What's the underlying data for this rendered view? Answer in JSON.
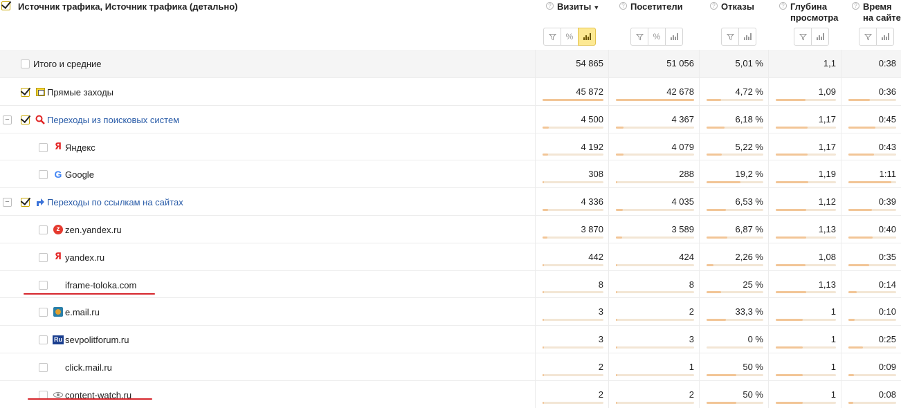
{
  "header": {
    "dimension_title": "Источник трафика, Источник трафика (детально)",
    "metrics": [
      {
        "name": "Визиты",
        "sort_indicator": "▼",
        "buttons": [
          "filter",
          "percent",
          "bars"
        ]
      },
      {
        "name": "Посетители",
        "buttons": [
          "filter",
          "percent",
          "bars"
        ]
      },
      {
        "name": "Отказы",
        "buttons": [
          "filter",
          "bars"
        ]
      },
      {
        "name": "Глубина\nпросмотра",
        "buttons": [
          "filter",
          "bars"
        ]
      },
      {
        "name": "Время\nна сайте",
        "buttons": [
          "filter",
          "bars"
        ]
      }
    ],
    "help_glyph": "?"
  },
  "rows": [
    {
      "label": "Итого и средние",
      "level": 0,
      "checked": false,
      "values": [
        "54 865",
        "51 056",
        "5,01 %",
        "1,1",
        "0:38"
      ],
      "fills": [
        0,
        0,
        0,
        0,
        0
      ]
    },
    {
      "label": "Прямые заходы",
      "level": 0,
      "checked": true,
      "icon": "direct-entry-icon",
      "values": [
        "45 872",
        "42 678",
        "4,72 %",
        "1,09",
        "0:36"
      ],
      "fills": [
        1.0,
        1.0,
        0.25,
        0.49,
        0.45
      ]
    },
    {
      "label": "Переходы из поисковых систем",
      "level": 0,
      "checked": true,
      "expandable": true,
      "link": true,
      "icon": "search-magnifier-icon",
      "values": [
        "4 500",
        "4 367",
        "6,18 %",
        "1,17",
        "0:45"
      ],
      "fills": [
        0.1,
        0.1,
        0.32,
        0.53,
        0.56
      ]
    },
    {
      "label": "Яндекс",
      "level": 1,
      "checked": false,
      "icon": "yandex-icon",
      "values": [
        "4 192",
        "4 079",
        "5,22 %",
        "1,17",
        "0:43"
      ],
      "fills": [
        0.09,
        0.1,
        0.27,
        0.53,
        0.54
      ]
    },
    {
      "label": "Google",
      "level": 1,
      "checked": false,
      "icon": "google-icon",
      "values": [
        "308",
        "288",
        "19,2 %",
        "1,19",
        "1:11"
      ],
      "fills": [
        0.01,
        0.01,
        0.6,
        0.54,
        0.9
      ]
    },
    {
      "label": "Переходы по ссылкам на сайтах",
      "level": 0,
      "checked": true,
      "expandable": true,
      "link": true,
      "icon": "link-arrow-icon",
      "values": [
        "4 336",
        "4 035",
        "6,53 %",
        "1,12",
        "0:39"
      ],
      "fills": [
        0.09,
        0.09,
        0.34,
        0.51,
        0.49
      ]
    },
    {
      "label": "zen.yandex.ru",
      "level": 1,
      "checked": false,
      "icon": "zen-icon",
      "values": [
        "3 870",
        "3 589",
        "6,87 %",
        "1,13",
        "0:40"
      ],
      "fills": [
        0.08,
        0.08,
        0.36,
        0.51,
        0.5
      ]
    },
    {
      "label": "yandex.ru",
      "level": 1,
      "checked": false,
      "icon": "yandex-icon",
      "values": [
        "442",
        "424",
        "2,26 %",
        "1,08",
        "0:35"
      ],
      "fills": [
        0.01,
        0.01,
        0.12,
        0.49,
        0.44
      ]
    },
    {
      "label": "iframe-toloka.com",
      "level": 1,
      "checked": false,
      "icon": "",
      "underlined": true,
      "values": [
        "8",
        "8",
        "25 %",
        "1,13",
        "0:14"
      ],
      "fills": [
        0.002,
        0.002,
        0.25,
        0.51,
        0.18
      ]
    },
    {
      "label": "e.mail.ru",
      "level": 1,
      "checked": false,
      "icon": "mail-ru-icon",
      "values": [
        "3",
        "2",
        "33,3 %",
        "1",
        "0:10"
      ],
      "fills": [
        0.001,
        0.001,
        0.34,
        0.45,
        0.13
      ]
    },
    {
      "label": "sevpolitforum.ru",
      "level": 1,
      "checked": false,
      "icon": "ru-icon",
      "values": [
        "3",
        "3",
        "0 %",
        "1",
        "0:25"
      ],
      "fills": [
        0.001,
        0.001,
        0,
        0.45,
        0.31
      ]
    },
    {
      "label": "click.mail.ru",
      "level": 1,
      "checked": false,
      "icon": "",
      "values": [
        "2",
        "1",
        "50 %",
        "1",
        "0:09"
      ],
      "fills": [
        0.001,
        0.001,
        0.52,
        0.45,
        0.11
      ]
    },
    {
      "label": "content-watch.ru",
      "level": 1,
      "checked": false,
      "icon": "eye-icon",
      "underlined": true,
      "values": [
        "2",
        "2",
        "50 %",
        "1",
        "0:08"
      ],
      "fills": [
        0.001,
        0.001,
        0.52,
        0.45,
        0.1
      ]
    }
  ]
}
